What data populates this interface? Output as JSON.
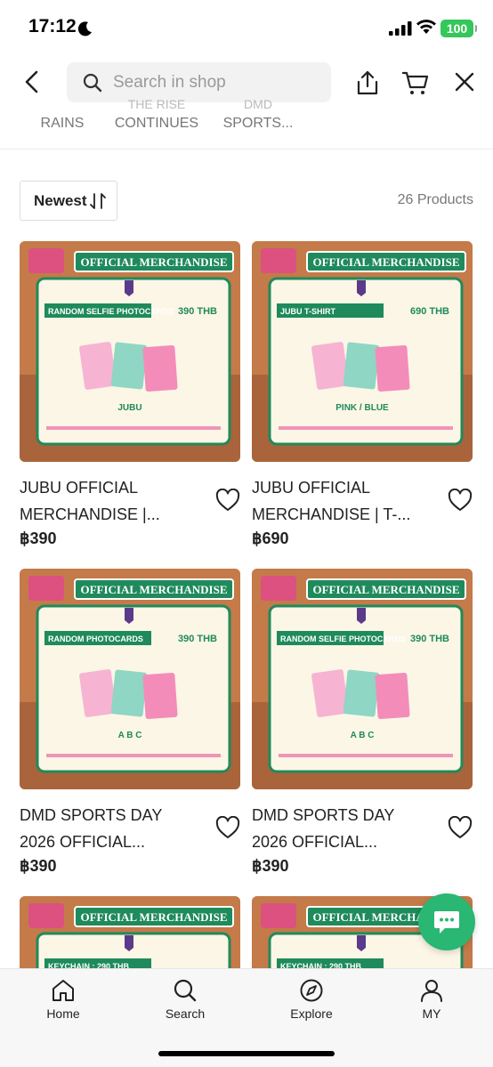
{
  "status_bar": {
    "time": "17:12",
    "battery": "100"
  },
  "header": {
    "search_placeholder": "Search in shop"
  },
  "tabs": [
    {
      "line1": "RAINS",
      "partial": ""
    },
    {
      "line1": "CONTINUES",
      "partial": "THE RISE"
    },
    {
      "line1": "SPORTS...",
      "partial": "DMD"
    }
  ],
  "sort": {
    "label": "Newest"
  },
  "product_count": "26 Products",
  "products": [
    {
      "name_line1": "JUBU OFFICIAL",
      "name_line2": "MERCHANDISE |...",
      "price": "฿390",
      "poster": {
        "banner": "OFFICIAL MERCHANDISE",
        "item": "RANDOM SELFIE PHOTOCARDS",
        "price": "390 THB",
        "sub": "JUBU"
      }
    },
    {
      "name_line1": "JUBU OFFICIAL",
      "name_line2": "MERCHANDISE | T-...",
      "price": "฿690",
      "poster": {
        "banner": "OFFICIAL MERCHANDISE",
        "item": "JUBU T-SHIRT",
        "price": "690 THB",
        "sub": "PINK / BLUE"
      }
    },
    {
      "name_line1": "DMD SPORTS DAY",
      "name_line2": "2026 OFFICIAL...",
      "price": "฿390",
      "poster": {
        "banner": "OFFICIAL MERCHANDISE",
        "item": "RANDOM PHOTOCARDS",
        "price": "390 THB",
        "sub": "A  B  C"
      }
    },
    {
      "name_line1": "DMD SPORTS DAY",
      "name_line2": "2026 OFFICIAL...",
      "price": "฿390",
      "poster": {
        "banner": "OFFICIAL MERCHANDISE",
        "item": "RANDOM SELFIE PHOTOCARDS",
        "price": "390 THB",
        "sub": "A  B  C"
      }
    },
    {
      "poster": {
        "banner": "OFFICIAL MERCHANDISE",
        "item": "KEYCHAIN : 290 THB"
      }
    },
    {
      "poster": {
        "banner": "OFFICIAL MERCHANDISE",
        "item": "KEYCHAIN : 290 THB"
      }
    }
  ],
  "bottom_nav": [
    {
      "label": "Home",
      "icon": "home-icon"
    },
    {
      "label": "Search",
      "icon": "search-icon"
    },
    {
      "label": "Explore",
      "icon": "compass-icon"
    },
    {
      "label": "MY",
      "icon": "user-icon"
    }
  ],
  "colors": {
    "accent_green": "#2ab673",
    "poster_green": "#1f8a5b",
    "poster_pink": "#e9559a",
    "poster_cream": "#fbf6e6"
  }
}
